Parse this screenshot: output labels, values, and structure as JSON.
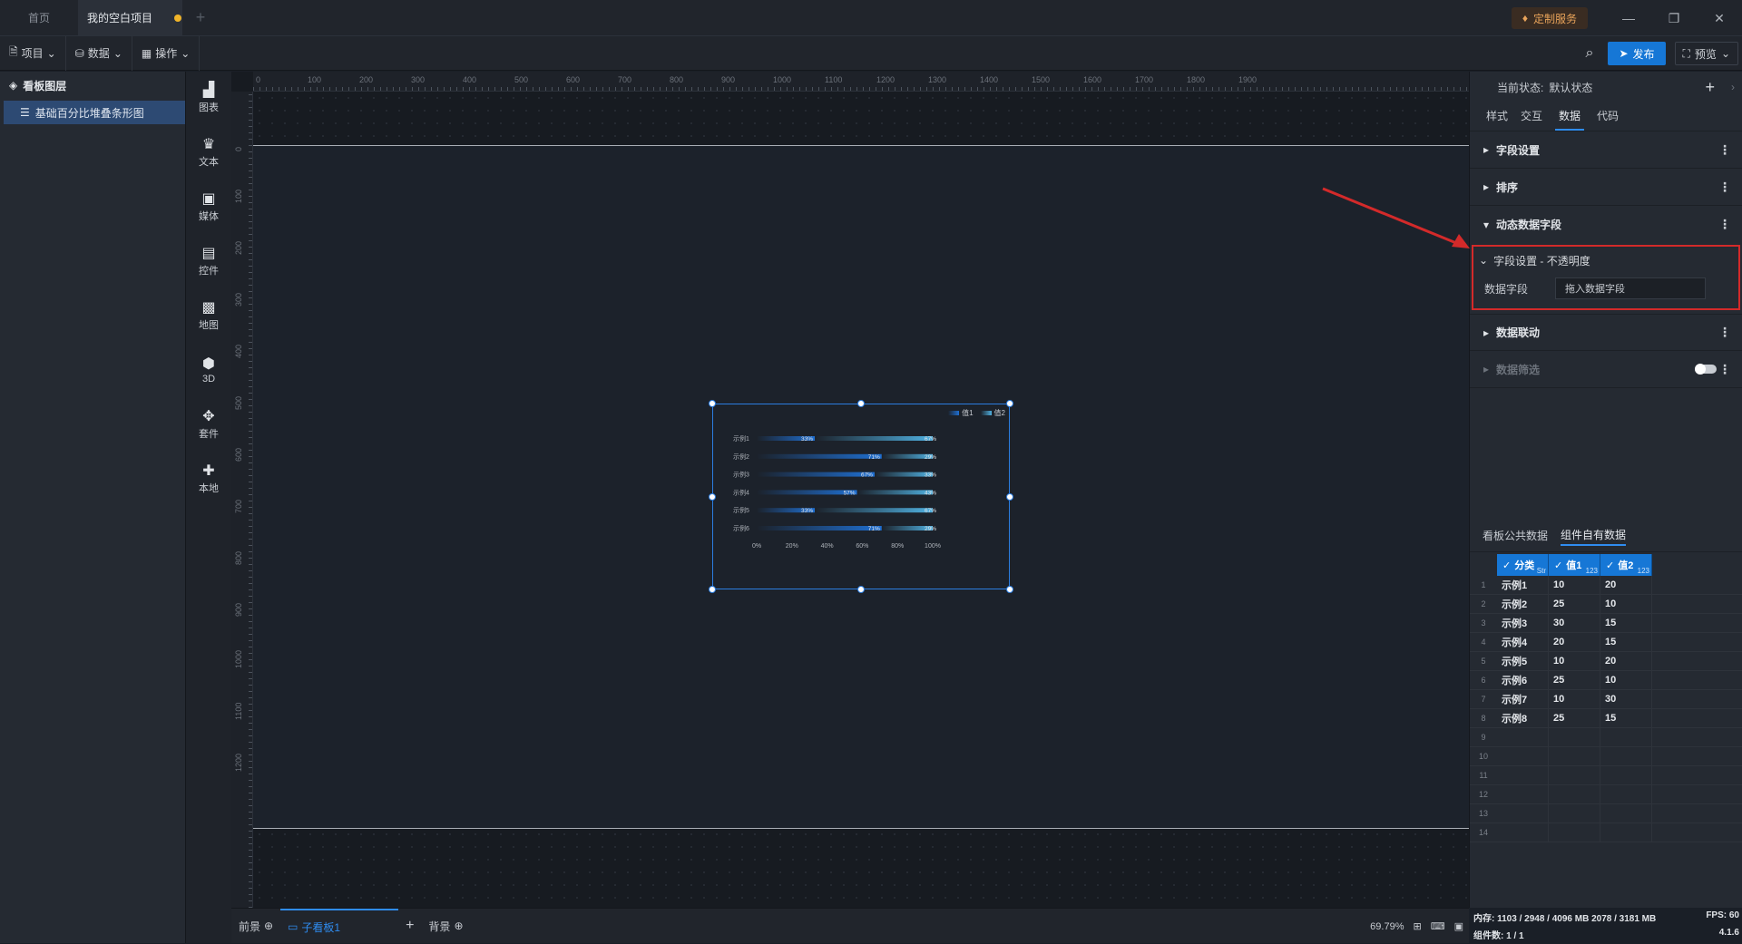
{
  "tabs": {
    "home": "首页",
    "project": "我的空白项目"
  },
  "top_right": {
    "custom_service": "定制服务"
  },
  "toolbar": {
    "project": "项目",
    "data": "数据",
    "ops": "操作",
    "publish": "发布",
    "preview": "预览"
  },
  "layers": {
    "title": "看板图层",
    "item": "基础百分比堆叠条形图"
  },
  "components": [
    {
      "label": "图表",
      "icon": "chart-icon"
    },
    {
      "label": "文本",
      "icon": "text-icon"
    },
    {
      "label": "媒体",
      "icon": "media-icon"
    },
    {
      "label": "控件",
      "icon": "control-icon"
    },
    {
      "label": "地图",
      "icon": "map-icon"
    },
    {
      "label": "3D",
      "icon": "cube-icon"
    },
    {
      "label": "套件",
      "icon": "kit-icon"
    },
    {
      "label": "本地",
      "icon": "puzzle-icon"
    }
  ],
  "ruler_h": [
    "0",
    "100",
    "200",
    "300",
    "400",
    "500",
    "600",
    "700",
    "800",
    "900",
    "1000",
    "1100",
    "1200",
    "1300",
    "1400",
    "1500",
    "1600",
    "1700",
    "1800",
    "1900"
  ],
  "ruler_v": [
    "0",
    "100",
    "200",
    "300",
    "400",
    "500",
    "600",
    "700",
    "800",
    "900",
    "1000",
    "1100",
    "1200"
  ],
  "chart_data": {
    "type": "bar",
    "orientation": "horizontal",
    "stacked": "percent",
    "categories": [
      "示例1",
      "示例2",
      "示例3",
      "示例4",
      "示例5",
      "示例6"
    ],
    "series": [
      {
        "name": "值1",
        "labels": [
          "33%",
          "71%",
          "67%",
          "57%",
          "33%",
          "71%"
        ],
        "values": [
          33,
          71,
          67,
          57,
          33,
          71
        ],
        "color": "#1f6fd1"
      },
      {
        "name": "值2",
        "labels": [
          "67%",
          "29%",
          "33%",
          "43%",
          "67%",
          "29%"
        ],
        "values": [
          67,
          29,
          33,
          43,
          67,
          29
        ],
        "color": "#4fb0e0"
      }
    ],
    "xticks": [
      "0%",
      "20%",
      "40%",
      "60%",
      "80%",
      "100%"
    ],
    "xlim": [
      0,
      100
    ],
    "legend": "top-right"
  },
  "bottom": {
    "fg": "前景",
    "board": "子看板1",
    "bg": "背景",
    "zoom": "69.79%"
  },
  "right": {
    "state_label": "当前状态:",
    "state_value": "默认状态",
    "tabs": [
      "样式",
      "交互",
      "数据",
      "代码"
    ],
    "sections": {
      "field": "字段设置",
      "sort": "排序",
      "dynamic": "动态数据字段",
      "link": "数据联动",
      "filter": "数据筛选"
    },
    "sub": {
      "title": "字段设置 - 不透明度",
      "field_label": "数据字段",
      "placeholder": "拖入数据字段"
    },
    "data_tabs": [
      "看板公共数据",
      "组件自有数据"
    ],
    "columns": [
      {
        "name": "分类",
        "type": "Str"
      },
      {
        "name": "值1",
        "type": "123"
      },
      {
        "name": "值2",
        "type": "123"
      }
    ],
    "rows": [
      [
        "示例1",
        "10",
        "20"
      ],
      [
        "示例2",
        "25",
        "10"
      ],
      [
        "示例3",
        "30",
        "15"
      ],
      [
        "示例4",
        "20",
        "15"
      ],
      [
        "示例5",
        "10",
        "20"
      ],
      [
        "示例6",
        "25",
        "10"
      ],
      [
        "示例7",
        "10",
        "30"
      ],
      [
        "示例8",
        "25",
        "15"
      ],
      [
        "",
        "",
        ""
      ],
      [
        "",
        "",
        ""
      ],
      [
        "",
        "",
        ""
      ],
      [
        "",
        "",
        ""
      ],
      [
        "",
        "",
        ""
      ],
      [
        "",
        "",
        ""
      ]
    ],
    "status_mem": "内存: 1103 / 2948 / 4096 MB 2078 / 3181 MB",
    "status_fps": "FPS: 60",
    "status_count": "组件数: 1 / 1",
    "version": "4.1.6"
  },
  "colors": {
    "accent": "#1677d6",
    "highlight": "#d32a2a"
  }
}
